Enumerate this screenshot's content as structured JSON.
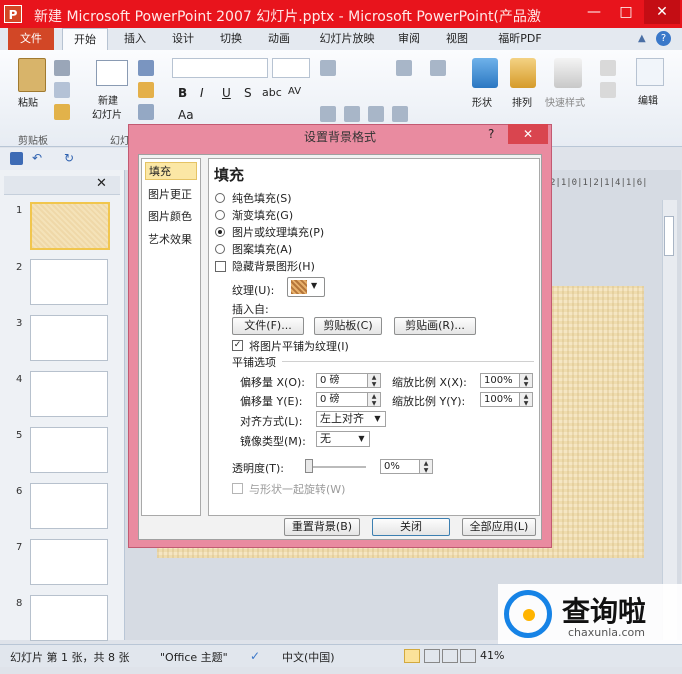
{
  "window": {
    "app_icon": "P",
    "title": "新建 Microsoft PowerPoint 2007 幻灯片.pptx - Microsoft PowerPoint(产品激",
    "minimize": "—",
    "maximize": "□",
    "close": "✕"
  },
  "tabs": [
    "文件",
    "开始",
    "插入",
    "设计",
    "切换",
    "动画",
    "幻灯片放映",
    "审阅",
    "视图",
    "福昕PDF"
  ],
  "ribbon": {
    "paste": "粘贴",
    "clipboard_group": "剪贴板",
    "new_slide_line1": "新建",
    "new_slide_line2": "幻灯片",
    "slides_group_partial": "幻灯",
    "bold": "B",
    "italic": "I",
    "underline": "U",
    "strike": "S",
    "abc": "abc",
    "av": "AV",
    "aa": "Aa",
    "shape": "形状",
    "arrange": "排列",
    "quick_style": "快速样式",
    "edit": "编辑"
  },
  "slide_thumbnails": [
    "1",
    "2",
    "3",
    "4",
    "5",
    "6",
    "7",
    "8"
  ],
  "ruler": "2|1|0|1|2|1|4|1|6|",
  "dialog": {
    "title": "设置背景格式",
    "help": "?",
    "close": "✕",
    "nav": [
      "填充",
      "图片更正",
      "图片颜色",
      "艺术效果"
    ],
    "heading": "填充",
    "options": {
      "solid": "纯色填充(S)",
      "gradient": "渐变填充(G)",
      "picture": "图片或纹理填充(P)",
      "pattern": "图案填充(A)",
      "hide_graphics": "隐藏背景图形(H)"
    },
    "texture_label": "纹理(U):",
    "insert_from": "插入自:",
    "btn_file": "文件(F)...",
    "btn_clipboard": "剪贴板(C)",
    "btn_clipart": "剪贴画(R)...",
    "tile_label": "将图片平铺为纹理(I)",
    "tile_options": "平铺选项",
    "offset_x_label": "偏移量 X(O):",
    "offset_x": "0 磅",
    "offset_y_label": "偏移量 Y(E):",
    "offset_y": "0 磅",
    "scale_x_label": "缩放比例 X(X):",
    "scale_x": "100%",
    "scale_y_label": "缩放比例 Y(Y):",
    "scale_y": "100%",
    "align_label": "对齐方式(L):",
    "align_value": "左上对齐",
    "mirror_label": "镜像类型(M):",
    "mirror_value": "无",
    "transparency_label": "透明度(T):",
    "transparency_value": "0%",
    "rotate_with_shape": "与形状一起旋转(W)",
    "btn_reset": "重置背景(B)",
    "btn_close": "关闭",
    "btn_apply_all": "全部应用(L)"
  },
  "status": {
    "slide_info": "幻灯片 第 1 张，共 8 张",
    "theme": "\"Office 主题\"",
    "language": "中文(中国)",
    "zoom": "41%"
  },
  "watermark": {
    "text_cn": "查询啦",
    "text_en": "chaxunla.com"
  },
  "colors": {
    "titlebar": "#e8141c",
    "file_tab": "#d24726",
    "dialog_frame": "#e98ba0",
    "selected_nav": "#fbe7a5"
  }
}
